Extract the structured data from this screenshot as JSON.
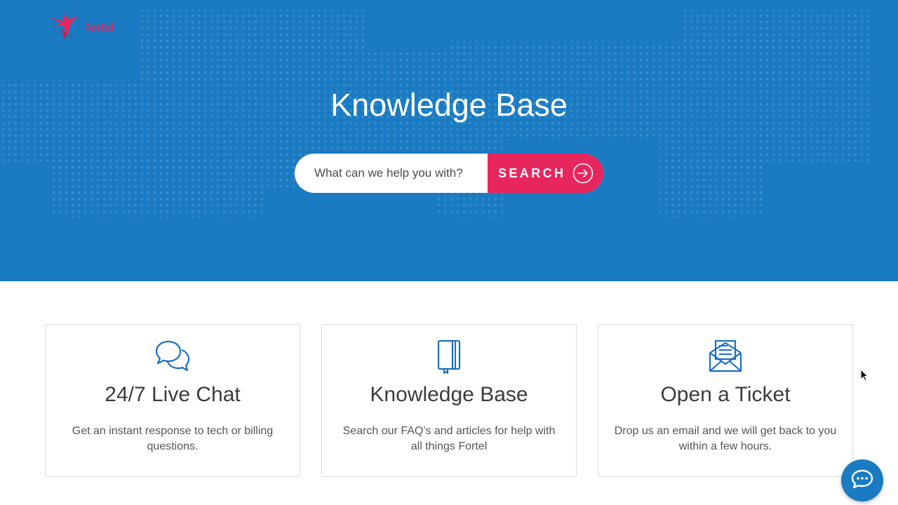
{
  "brand": {
    "name": "fortel",
    "logo_icon": "bird-globe-logo",
    "accent_color": "#e8265e",
    "primary_color": "#1a7bc2"
  },
  "hero": {
    "title": "Knowledge Base",
    "search": {
      "placeholder": "What can we help you with?",
      "button_label": "SEARCH",
      "button_icon": "arrow-right-circle-icon"
    }
  },
  "cards": [
    {
      "icon": "chat-bubbles-icon",
      "title": "24/7 Live Chat",
      "description": "Get an instant response to tech or billing questions."
    },
    {
      "icon": "book-icon",
      "title": "Knowledge Base",
      "description": "Search our FAQ's and articles for help with all things Fortel"
    },
    {
      "icon": "envelope-letter-icon",
      "title": "Open a Ticket",
      "description": "Drop us an email and we will get back to you within a few hours."
    }
  ],
  "chat_widget": {
    "icon": "chat-bubble-icon"
  }
}
